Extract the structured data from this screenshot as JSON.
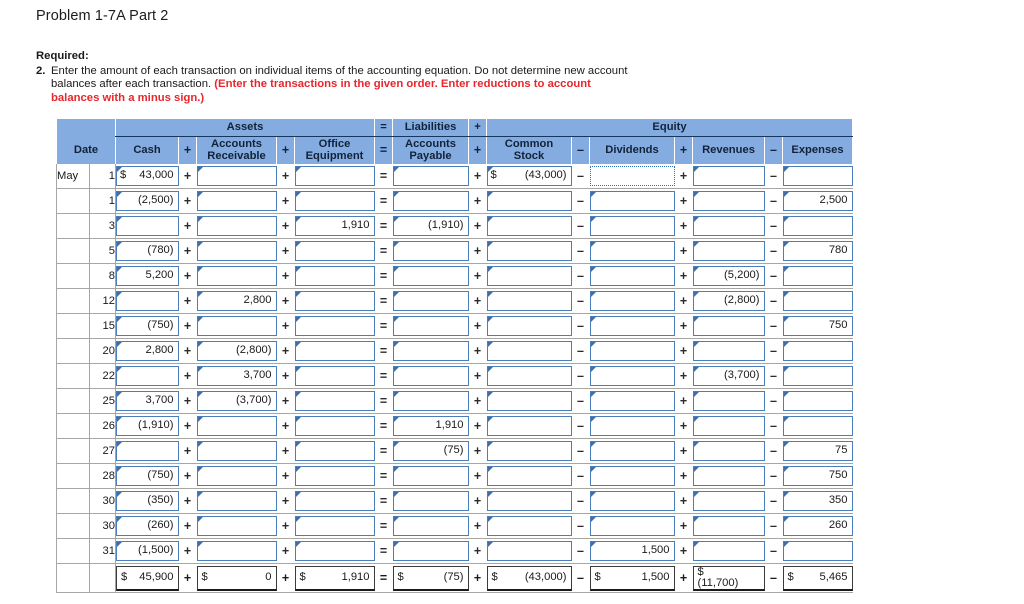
{
  "title": "Problem 1-7A Part 2",
  "instructions": {
    "required_label": "Required:",
    "number": "2.",
    "text_plain": "Enter the amount of each transaction on individual items of the accounting equation. Do not determine new account balances after each transaction. ",
    "text_red": "(Enter the transactions in the given order. Enter reductions to account balances with a minus sign.)"
  },
  "table": {
    "group_headers": {
      "assets": "Assets",
      "eq1": "=",
      "liabilities": "Liabilities",
      "plus1": "+",
      "equity": "Equity"
    },
    "columns": {
      "date": "Date",
      "cash": "Cash",
      "op_a1": "+",
      "accounts_receivable": "Accounts\nReceivable",
      "op_a2": "+",
      "office_equipment": "Office\nEquipment",
      "op_eq": "=",
      "accounts_payable": "Accounts\nPayable",
      "op_p1": "+",
      "common_stock": "Common\nStock",
      "op_m1": "–",
      "dividends": "Dividends",
      "op_p2": "+",
      "revenues": "Revenues",
      "op_m2": "–",
      "expenses": "Expenses"
    },
    "rows": [
      {
        "month": "May",
        "day": "1",
        "cash_sym": "$",
        "cash": "43,000",
        "ar": "",
        "oe": "",
        "ap": "",
        "cs_sym": "$",
        "cs": "(43,000)",
        "div": "",
        "div_selected": true,
        "rev": "",
        "exp": ""
      },
      {
        "month": "",
        "day": "1",
        "cash_sym": "",
        "cash": "(2,500)",
        "ar": "",
        "oe": "",
        "ap": "",
        "cs_sym": "",
        "cs": "",
        "div": "",
        "rev": "",
        "exp": "2,500"
      },
      {
        "month": "",
        "day": "3",
        "cash_sym": "",
        "cash": "",
        "ar": "",
        "oe": "1,910",
        "ap": "(1,910)",
        "cs_sym": "",
        "cs": "",
        "div": "",
        "rev": "",
        "exp": ""
      },
      {
        "month": "",
        "day": "5",
        "cash_sym": "",
        "cash": "(780)",
        "ar": "",
        "oe": "",
        "ap": "",
        "cs_sym": "",
        "cs": "",
        "div": "",
        "rev": "",
        "exp": "780"
      },
      {
        "month": "",
        "day": "8",
        "cash_sym": "",
        "cash": "5,200",
        "ar": "",
        "oe": "",
        "ap": "",
        "cs_sym": "",
        "cs": "",
        "div": "",
        "rev": "(5,200)",
        "exp": ""
      },
      {
        "month": "",
        "day": "12",
        "cash_sym": "",
        "cash": "",
        "ar": "2,800",
        "oe": "",
        "ap": "",
        "cs_sym": "",
        "cs": "",
        "div": "",
        "rev": "(2,800)",
        "exp": ""
      },
      {
        "month": "",
        "day": "15",
        "cash_sym": "",
        "cash": "(750)",
        "ar": "",
        "oe": "",
        "ap": "",
        "cs_sym": "",
        "cs": "",
        "div": "",
        "rev": "",
        "exp": "750"
      },
      {
        "month": "",
        "day": "20",
        "cash_sym": "",
        "cash": "2,800",
        "ar": "(2,800)",
        "oe": "",
        "ap": "",
        "cs_sym": "",
        "cs": "",
        "div": "",
        "rev": "",
        "exp": ""
      },
      {
        "month": "",
        "day": "22",
        "cash_sym": "",
        "cash": "",
        "ar": "3,700",
        "oe": "",
        "ap": "",
        "cs_sym": "",
        "cs": "",
        "div": "",
        "rev": "(3,700)",
        "exp": ""
      },
      {
        "month": "",
        "day": "25",
        "cash_sym": "",
        "cash": "3,700",
        "ar": "(3,700)",
        "oe": "",
        "ap": "",
        "cs_sym": "",
        "cs": "",
        "div": "",
        "rev": "",
        "exp": ""
      },
      {
        "month": "",
        "day": "26",
        "cash_sym": "",
        "cash": "(1,910)",
        "ar": "",
        "oe": "",
        "ap": "1,910",
        "cs_sym": "",
        "cs": "",
        "div": "",
        "rev": "",
        "exp": ""
      },
      {
        "month": "",
        "day": "27",
        "cash_sym": "",
        "cash": "",
        "ar": "",
        "oe": "",
        "ap": "(75)",
        "cs_sym": "",
        "cs": "",
        "div": "",
        "rev": "",
        "exp": "75"
      },
      {
        "month": "",
        "day": "28",
        "cash_sym": "",
        "cash": "(750)",
        "ar": "",
        "oe": "",
        "ap": "",
        "cs_sym": "",
        "cs": "",
        "div": "",
        "rev": "",
        "exp": "750"
      },
      {
        "month": "",
        "day": "30",
        "cash_sym": "",
        "cash": "(350)",
        "ar": "",
        "oe": "",
        "ap": "",
        "cs_sym": "",
        "cs": "",
        "div": "",
        "rev": "",
        "exp": "350"
      },
      {
        "month": "",
        "day": "30",
        "cash_sym": "",
        "cash": "(260)",
        "ar": "",
        "oe": "",
        "ap": "",
        "cs_sym": "",
        "cs": "",
        "div": "",
        "rev": "",
        "exp": "260"
      },
      {
        "month": "",
        "day": "31",
        "cash_sym": "",
        "cash": "(1,500)",
        "ar": "",
        "oe": "",
        "ap": "",
        "cs_sym": "",
        "cs": "",
        "div": "1,500",
        "rev": "",
        "exp": ""
      }
    ],
    "totals": {
      "cash_sym": "$",
      "cash": "45,900",
      "ar_sym": "$",
      "ar": "0",
      "oe_sym": "$",
      "oe": "1,910",
      "ap_sym": "$",
      "ap": "(75)",
      "cs_sym": "$",
      "cs": "(43,000)",
      "div_sym": "$",
      "div": "1,500",
      "rev_sym": "$",
      "rev": "(11,700)",
      "exp_sym": "$",
      "exp": "5,465"
    }
  },
  "colors": {
    "header_blue": "#85ACE0",
    "cell_border_blue": "#4A7EBB",
    "selected_blue": "#2F6FC4",
    "alert_red": "#E8262C",
    "group_rule": "#17365D"
  }
}
